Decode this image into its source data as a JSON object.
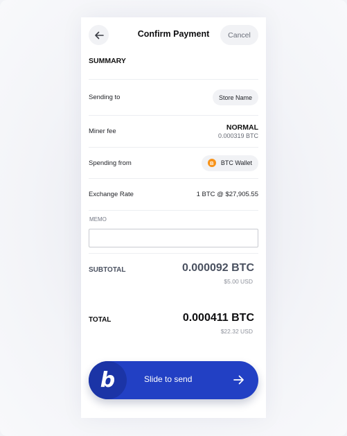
{
  "header": {
    "title": "Confirm Payment",
    "cancel_label": "Cancel",
    "back_icon": "arrow-left-icon"
  },
  "summary": {
    "heading": "SUMMARY",
    "rows": {
      "sending_to": {
        "label": "Sending to",
        "value": "Store Name"
      },
      "miner_fee": {
        "label": "Miner fee",
        "level": "NORMAL",
        "amount": "0.000319 BTC"
      },
      "spending_from": {
        "label": "Spending from",
        "value": "BTC Wallet",
        "icon": "bitcoin-icon",
        "icon_glyph": "B"
      },
      "exchange_rate": {
        "label": "Exchange Rate",
        "value": "1 BTC @ $27,905.55"
      }
    }
  },
  "memo": {
    "label": "MEMO",
    "value": "",
    "placeholder": ""
  },
  "subtotal": {
    "label": "SUBTOTAL",
    "amount": "0.000092 BTC",
    "fiat": "$5.00 USD"
  },
  "total": {
    "label": "TOTAL",
    "amount": "0.000411 BTC",
    "fiat": "$22.32 USD"
  },
  "slider": {
    "label": "Slide to send",
    "knob_glyph": "b",
    "arrow_icon": "arrow-right-icon"
  },
  "colors": {
    "accent": "#2240c4",
    "knob": "#1b34a6",
    "bitcoin": "#f7931a"
  }
}
